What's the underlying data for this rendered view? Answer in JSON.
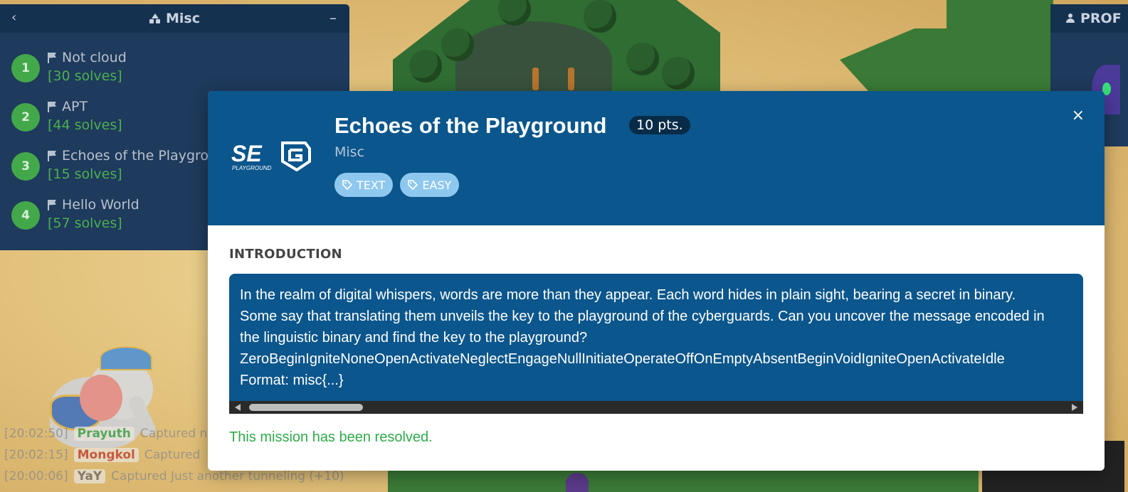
{
  "misc_panel": {
    "title": "Misc",
    "challenges": [
      {
        "num": "1",
        "name": "Not cloud",
        "solves": "[30 solves]"
      },
      {
        "num": "2",
        "name": "APT",
        "solves": "[44 solves]"
      },
      {
        "num": "3",
        "name": "Echoes of the Playground",
        "solves": "[15 solves]"
      },
      {
        "num": "4",
        "name": "Hello World",
        "solves": "[57 solves]"
      }
    ]
  },
  "log": [
    {
      "time": "[20:02:50]",
      "name": "Prayuth",
      "name_color": "#2e9a3a",
      "text": "Captured n"
    },
    {
      "time": "[20:02:15]",
      "name": "Mongkol",
      "name_color": "#c0392b",
      "text": "Captured"
    },
    {
      "time": "[20:00:06]",
      "name": "YaY",
      "name_color": "#666666",
      "text": "Captured Just another tunneling (+10)"
    }
  ],
  "right_panel": {
    "title": "PROF"
  },
  "modal": {
    "logo_text": "SE",
    "logo_sub": "PLAYGROUND",
    "title": "Echoes of the Playground",
    "points": "10 pts.",
    "category": "Misc",
    "tags": [
      "TEXT",
      "EASY"
    ],
    "close": "×",
    "section_title": "INTRODUCTION",
    "description": "In the realm of digital whispers, words are more than they appear. Each word hides in plain sight, bearing a secret in binary. Some say that translating them unveils the key to the playground of the cyberguards. Can you uncover the message encoded in the linguistic binary and find the key to the playground?",
    "encoded": "ZeroBeginIgniteNoneOpenActivateNeglectEngageNullInitiateOperateOffOnEmptyAbsentBeginVoidIgniteOpenActivateIdle",
    "format": "Format: misc{...}",
    "status": "This mission has been resolved."
  },
  "colors": {
    "panel": "#1e3a5c",
    "modal_header": "#0b568c",
    "solves_green": "#4caf50",
    "tag_bg": "#8fc8ef",
    "resolved_green": "#2eab4a"
  }
}
